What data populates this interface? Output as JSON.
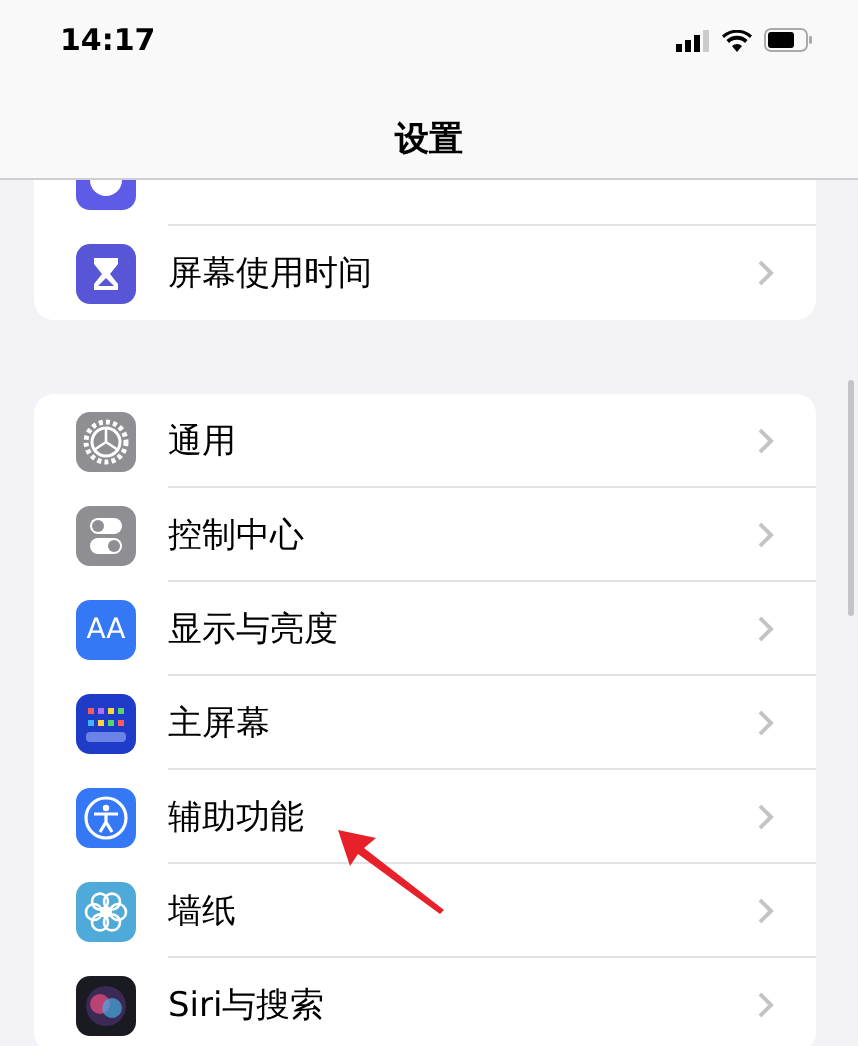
{
  "status_bar": {
    "time": "14:17"
  },
  "header": {
    "title": "设置"
  },
  "groups": [
    {
      "rows": [
        {
          "kind": "focus",
          "partial": true
        },
        {
          "kind": "hourglass",
          "label": "屏幕使用时间",
          "partial": false
        }
      ]
    },
    {
      "rows": [
        {
          "kind": "gear",
          "label": "通用",
          "partial": false
        },
        {
          "kind": "toggles",
          "label": "控制中心",
          "partial": false
        },
        {
          "kind": "textsize",
          "icon_label": "AA",
          "label": "显示与亮度",
          "partial": false
        },
        {
          "kind": "grid",
          "label": "主屏幕",
          "partial": false
        },
        {
          "kind": "accessibility",
          "label": "辅助功能",
          "partial": false
        },
        {
          "kind": "flower",
          "label": "墙纸",
          "partial": false
        },
        {
          "kind": "orb",
          "label": "Siri与搜索",
          "partial": false
        }
      ]
    }
  ]
}
